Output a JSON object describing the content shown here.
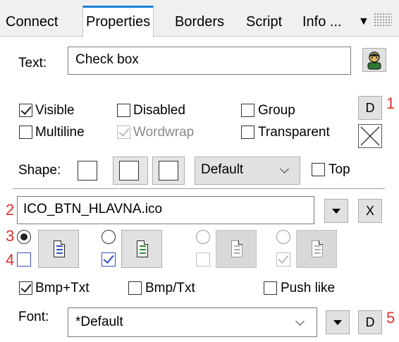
{
  "tabs": [
    {
      "label": "Connect",
      "active": false
    },
    {
      "label": "Properties",
      "active": true
    },
    {
      "label": "Borders",
      "active": false
    },
    {
      "label": "Script",
      "active": false
    },
    {
      "label": "Info ...",
      "active": false
    }
  ],
  "text_row": {
    "label": "Text:",
    "value": "Check box"
  },
  "flags": {
    "visible": {
      "label": "Visible",
      "checked": true
    },
    "disabled": {
      "label": "Disabled",
      "checked": false
    },
    "group": {
      "label": "Group",
      "checked": false
    },
    "multiline": {
      "label": "Multiline",
      "checked": false
    },
    "wordwrap": {
      "label": "Wordwrap",
      "checked": true,
      "enabled": false
    },
    "transparent": {
      "label": "Transparent",
      "checked": false
    }
  },
  "d_button_label": "D",
  "shape": {
    "label": "Shape:",
    "dropdown_value": "Default",
    "top_label": "Top",
    "top_checked": false
  },
  "icon_file": {
    "value": "ICO_BTN_HLAVNA.ico",
    "clear_label": "X"
  },
  "bmp_options": {
    "bmp_txt": {
      "label": "Bmp+Txt",
      "checked": true
    },
    "bmp_slash_txt": {
      "label": "Bmp/Txt",
      "checked": false
    },
    "push_like": {
      "label": "Push like",
      "checked": false
    }
  },
  "font": {
    "label": "Font:",
    "value": "*Default",
    "d_label": "D"
  },
  "annotations": {
    "n1": "1",
    "n2": "2",
    "n3": "3",
    "n4": "4",
    "n5": "5"
  },
  "colors": {
    "accent_tab": "#1a7fd6",
    "annotation_red": "#e0302f",
    "doc_blue": "#2f4cb8",
    "doc_green": "#2f8a3a"
  },
  "icons": [
    "dropdown-triangle-icon",
    "gripper-icon",
    "user-icon",
    "close-x-icon",
    "document-icon",
    "chevron-down-icon"
  ]
}
